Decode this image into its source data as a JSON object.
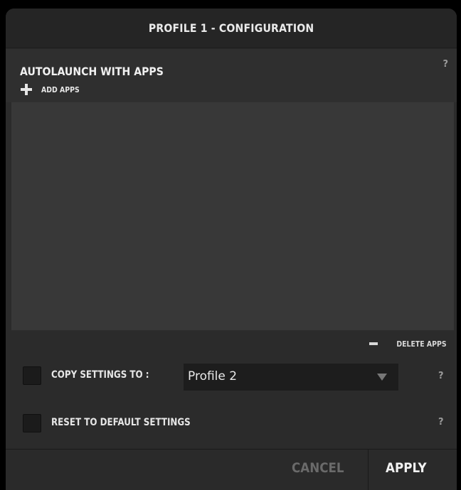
{
  "dialog": {
    "title": "PROFILE 1 - CONFIGURATION"
  },
  "autolaunch": {
    "title": "AUTOLAUNCH WITH APPS",
    "help": "?",
    "add_apps_label": "ADD APPS",
    "add_icon": "plus-icon",
    "apps": [],
    "delete_apps_label": "DELETE APPS",
    "delete_icon": "minus-icon"
  },
  "copy_settings": {
    "label": "COPY SETTINGS TO :",
    "checked": false,
    "selected_profile": "Profile 2",
    "dropdown_icon": "chevron-down-icon",
    "help": "?"
  },
  "reset_settings": {
    "label": "RESET TO DEFAULT SETTINGS",
    "checked": false,
    "help": "?"
  },
  "footer": {
    "cancel_label": "CANCEL",
    "apply_label": "APPLY"
  },
  "colors": {
    "background": "#000000",
    "dialog": "#2b2b2b",
    "list": "#383838",
    "text": "#e6e6e6",
    "disabled_text": "#6a6a6a"
  }
}
